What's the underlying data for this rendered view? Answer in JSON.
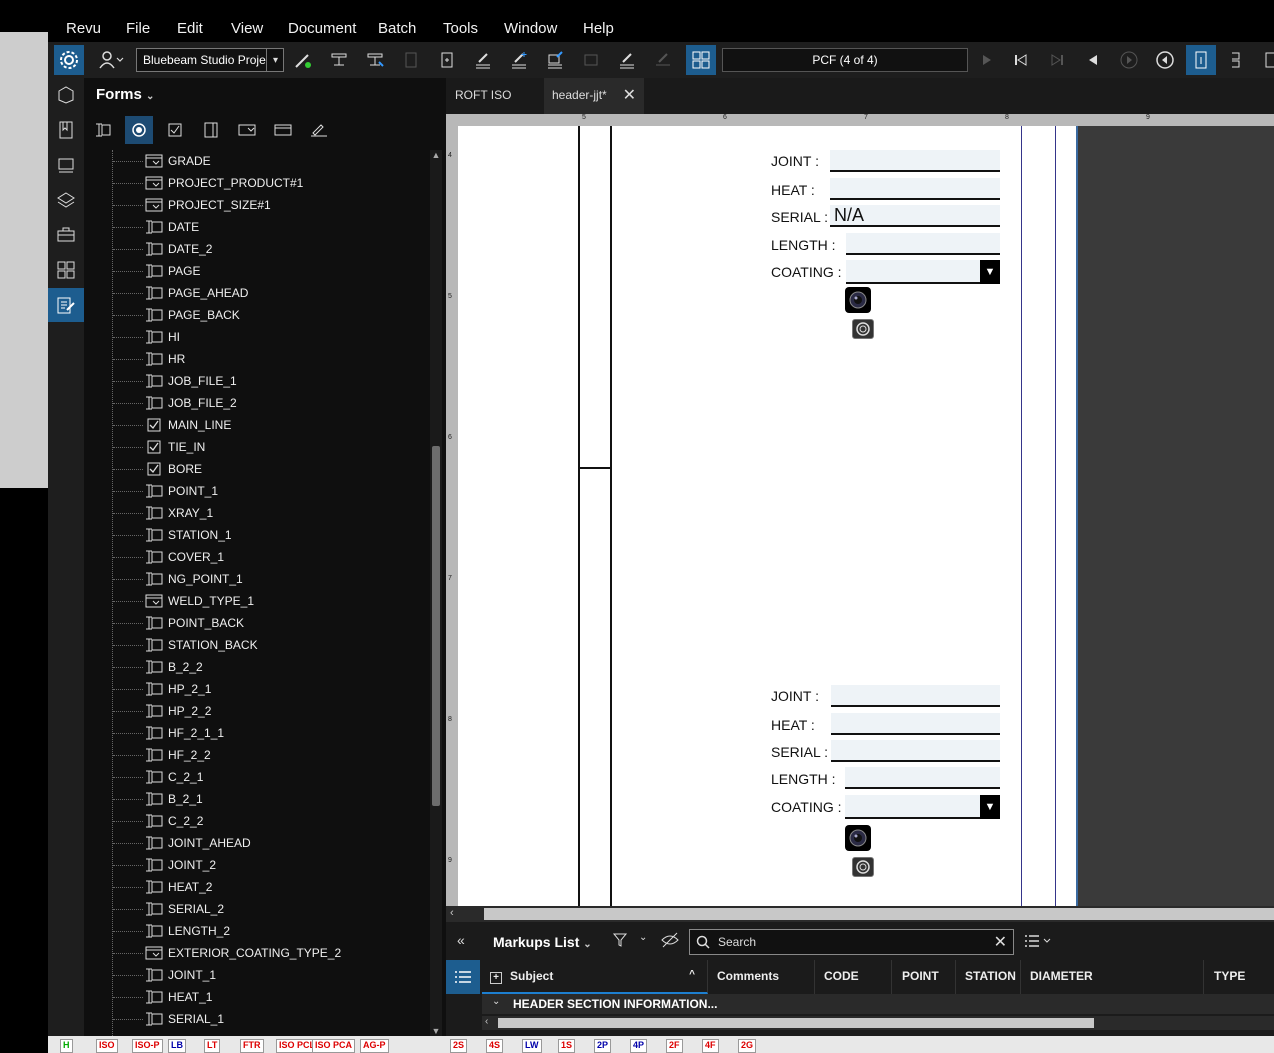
{
  "menu": [
    "Revu",
    "File",
    "Edit",
    "View",
    "Document",
    "Batch",
    "Tools",
    "Window",
    "Help"
  ],
  "toolbar": {
    "profile": "Bluebeam Studio Proje",
    "page_indicator": "PCF (4 of 4)"
  },
  "forms_panel": {
    "title": "Forms",
    "fields": [
      {
        "label": "GRADE",
        "type": "dropdown"
      },
      {
        "label": "PROJECT_PRODUCT#1",
        "type": "dropdown"
      },
      {
        "label": "PROJECT_SIZE#1",
        "type": "dropdown"
      },
      {
        "label": "DATE",
        "type": "text"
      },
      {
        "label": "DATE_2",
        "type": "text"
      },
      {
        "label": "PAGE",
        "type": "text"
      },
      {
        "label": "PAGE_AHEAD",
        "type": "text"
      },
      {
        "label": "PAGE_BACK",
        "type": "text"
      },
      {
        "label": "HI",
        "type": "text"
      },
      {
        "label": "HR",
        "type": "text"
      },
      {
        "label": "JOB_FILE_1",
        "type": "text"
      },
      {
        "label": "JOB_FILE_2",
        "type": "text"
      },
      {
        "label": "MAIN_LINE",
        "type": "checkbox"
      },
      {
        "label": "TIE_IN",
        "type": "checkbox"
      },
      {
        "label": "BORE",
        "type": "checkbox"
      },
      {
        "label": "POINT_1",
        "type": "text"
      },
      {
        "label": "XRAY_1",
        "type": "text"
      },
      {
        "label": "STATION_1",
        "type": "text"
      },
      {
        "label": "COVER_1",
        "type": "text"
      },
      {
        "label": "NG_POINT_1",
        "type": "text"
      },
      {
        "label": "WELD_TYPE_1",
        "type": "dropdown"
      },
      {
        "label": "POINT_BACK",
        "type": "text"
      },
      {
        "label": "STATION_BACK",
        "type": "text"
      },
      {
        "label": "B_2_2",
        "type": "text"
      },
      {
        "label": "HP_2_1",
        "type": "text"
      },
      {
        "label": "HP_2_2",
        "type": "text"
      },
      {
        "label": "HF_2_1_1",
        "type": "text"
      },
      {
        "label": "HF_2_2",
        "type": "text"
      },
      {
        "label": "C_2_1",
        "type": "text"
      },
      {
        "label": "B_2_1",
        "type": "text"
      },
      {
        "label": "C_2_2",
        "type": "text"
      },
      {
        "label": "JOINT_AHEAD",
        "type": "text"
      },
      {
        "label": "JOINT_2",
        "type": "text"
      },
      {
        "label": "HEAT_2",
        "type": "text"
      },
      {
        "label": "SERIAL_2",
        "type": "text"
      },
      {
        "label": "LENGTH_2",
        "type": "text"
      },
      {
        "label": "EXTERIOR_COATING_TYPE_2",
        "type": "dropdown"
      },
      {
        "label": "JOINT_1",
        "type": "text"
      },
      {
        "label": "HEAT_1",
        "type": "text"
      },
      {
        "label": "SERIAL_1",
        "type": "text"
      }
    ]
  },
  "tabs": [
    {
      "label": "ROFT ISO"
    },
    {
      "label": "header-jjt*"
    }
  ],
  "ruler": {
    "top": [
      "5",
      "6",
      "7",
      "8",
      "9"
    ],
    "left": [
      "4",
      "5",
      "6",
      "7",
      "8",
      "9"
    ]
  },
  "document": {
    "form_a": {
      "joint_label": "JOINT :",
      "joint_value": "",
      "heat_label": "HEAT :",
      "heat_value": "",
      "serial_label": "SERIAL :",
      "serial_value": "N/A",
      "length_label": "LENGTH :",
      "length_value": "",
      "coating_label": "COATING :",
      "coating_value": ""
    },
    "form_b": {
      "joint_label": "JOINT :",
      "joint_value": "",
      "heat_label": "HEAT :",
      "heat_value": "",
      "serial_label": "SERIAL :",
      "serial_value": "",
      "length_label": "LENGTH :",
      "length_value": "",
      "coating_label": "COATING :",
      "coating_value": ""
    }
  },
  "markups": {
    "title": "Markups List",
    "search_placeholder": "Search",
    "columns": [
      "Subject",
      "Comments",
      "CODE",
      "POINT",
      "STATION",
      "DIAMETER",
      "TYPE"
    ],
    "group_row": "HEADER SECTION INFORMATION..."
  },
  "bottom_stamps": [
    "H",
    "ISO",
    "ISO-P",
    "LB",
    "LT",
    "FTR",
    "ISO PCL",
    "ISO PCA",
    "AG-P",
    "2S",
    "4S",
    "LW",
    "1S",
    "2P",
    "4P",
    "2F",
    "4F",
    "2G"
  ]
}
